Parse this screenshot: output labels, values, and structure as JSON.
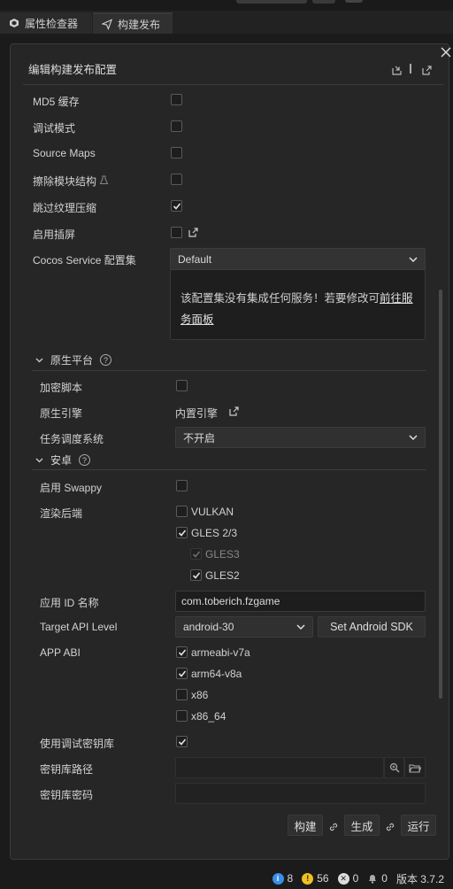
{
  "tabs": [
    {
      "label": "属性检查器",
      "icon": "inspector-icon"
    },
    {
      "label": "构建发布",
      "icon": "paper-plane-icon"
    }
  ],
  "panel": {
    "title": "编辑构建发布配置",
    "icons": [
      "import-icon",
      "export-icon"
    ]
  },
  "rows": {
    "md5": {
      "label": "MD5 缓存",
      "checked": false
    },
    "debug": {
      "label": "调试模式",
      "checked": false
    },
    "sourcemaps": {
      "label": "Source Maps",
      "checked": false
    },
    "erase_module": {
      "label": "擦除模块结构",
      "checked": false,
      "icon": "flask-icon"
    },
    "skip_texture": {
      "label": "跳过纹理压缩",
      "checked": true
    },
    "insert_screen": {
      "label": "启用插屏",
      "checked": false,
      "icon": "external-link-icon"
    },
    "cocos_service": {
      "label": "Cocos Service 配置集",
      "value": "Default"
    }
  },
  "service_info": {
    "text": "该配置集没有集成任何服务！若要修改可",
    "link": "前往服务面板"
  },
  "native": {
    "section_title": "原生平台",
    "encrypt": {
      "label": "加密脚本",
      "checked": false
    },
    "engine": {
      "label": "原生引擎",
      "value": "内置引擎"
    },
    "task_system": {
      "label": "任务调度系统",
      "value": "不开启"
    }
  },
  "android": {
    "section_title": "安卓",
    "swappy": {
      "label": "启用 Swappy",
      "checked": false
    },
    "render_backend": {
      "label": "渲染后端",
      "options": [
        {
          "label": "VULKAN",
          "checked": false
        },
        {
          "label": "GLES 2/3",
          "checked": true
        },
        {
          "label": "GLES3",
          "checked": true,
          "disabled": true
        },
        {
          "label": "GLES2",
          "checked": true
        }
      ]
    },
    "app_id": {
      "label": "应用 ID 名称",
      "value": "com.toberich.fzgame"
    },
    "target_api": {
      "label": "Target API Level",
      "value": "android-30",
      "sdk_button": "Set Android SDK"
    },
    "app_abi": {
      "label": "APP ABI",
      "options": [
        {
          "label": "armeabi-v7a",
          "checked": true
        },
        {
          "label": "arm64-v8a",
          "checked": true
        },
        {
          "label": "x86",
          "checked": false
        },
        {
          "label": "x86_64",
          "checked": false
        }
      ]
    },
    "debug_keystore": {
      "label": "使用调试密钥库",
      "checked": true
    },
    "keystore_path": {
      "label": "密钥库路径",
      "value": ""
    },
    "keystore_password": {
      "label": "密钥库密码",
      "value": ""
    }
  },
  "actions": {
    "build": "构建",
    "make": "生成",
    "run": "运行"
  },
  "status": {
    "info_count": "8",
    "warn_count": "56",
    "error_count": "0",
    "notify_count": "0",
    "version": "版本 3.7.2"
  }
}
